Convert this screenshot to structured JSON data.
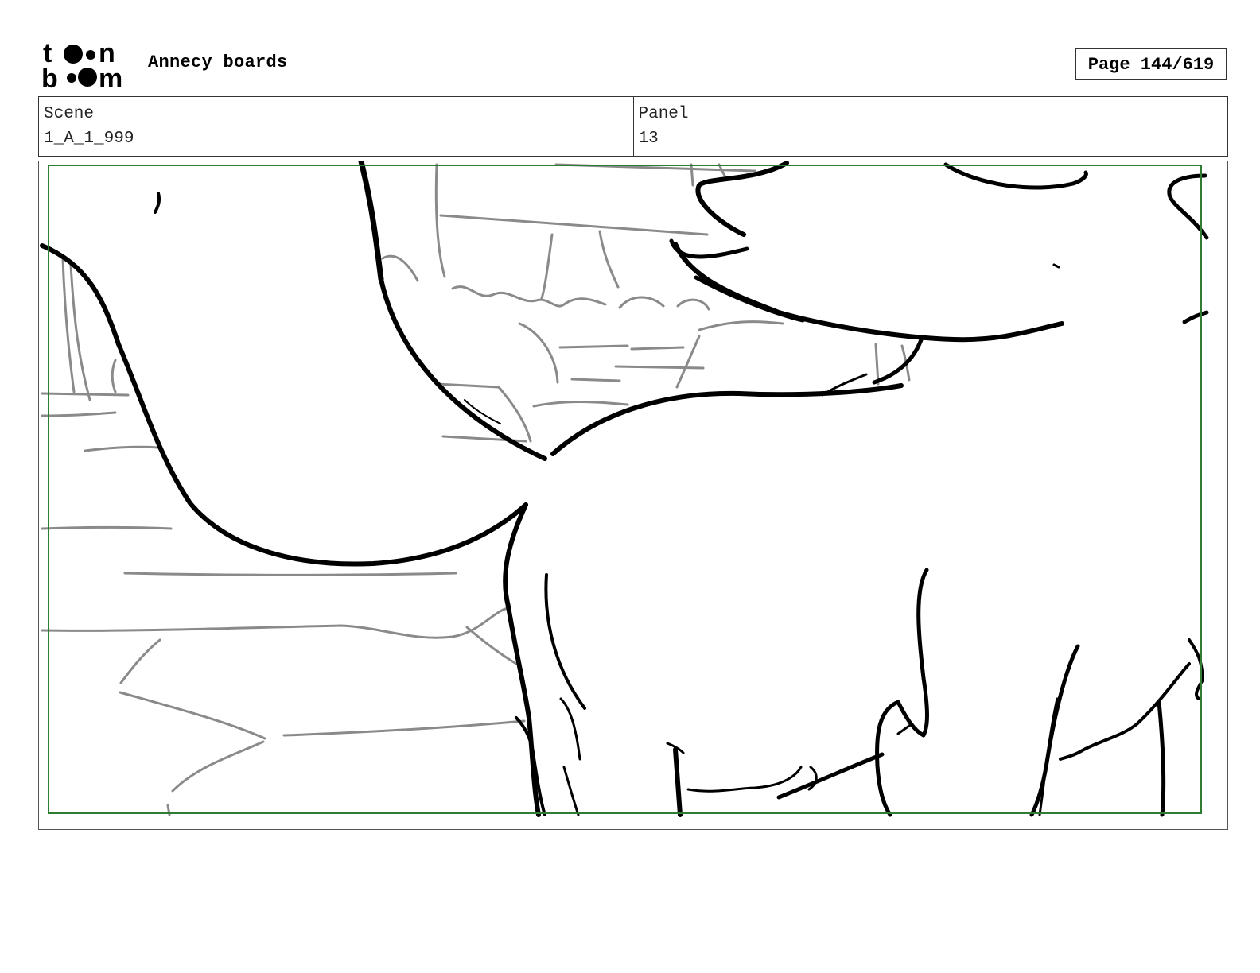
{
  "header": {
    "logo_text_top": "toon",
    "logo_text_bottom": "boom",
    "title": "Annecy boards",
    "page": "Page 144/619"
  },
  "info": {
    "scene_label": "Scene",
    "scene_value": "1_A_1_999",
    "panel_label": "Panel",
    "panel_value": "13"
  },
  "colors": {
    "safe_frame": "#2e7d32",
    "background_sketch": "#8a8a8a",
    "character_ink": "#000000"
  }
}
